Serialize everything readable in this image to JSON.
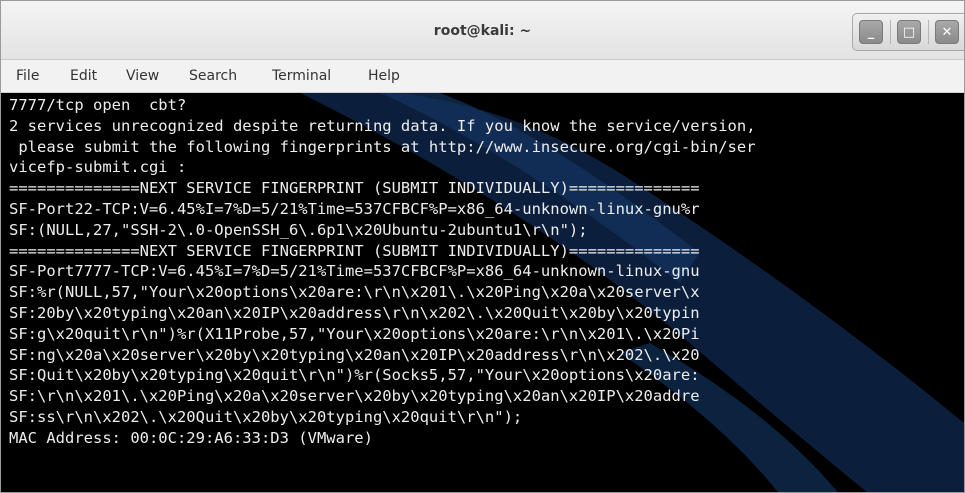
{
  "window": {
    "title": "root@kali: ~",
    "controls": {
      "minimize_glyph": "_",
      "maximize_glyph": "□",
      "close_glyph": "✕"
    }
  },
  "menubar": {
    "items": [
      "File",
      "Edit",
      "View",
      "Search",
      "Terminal",
      "Help"
    ]
  },
  "terminal": {
    "colors": {
      "background": "#000000",
      "foreground": "#ededed",
      "accent": "#0f2a55"
    },
    "lines": [
      "7777/tcp open  cbt?",
      "2 services unrecognized despite returning data. If you know the service/version,",
      " please submit the following fingerprints at http://www.insecure.org/cgi-bin/ser",
      "vicefp-submit.cgi :",
      "==============NEXT SERVICE FINGERPRINT (SUBMIT INDIVIDUALLY)==============",
      "SF-Port22-TCP:V=6.45%I=7%D=5/21%Time=537CFBCF%P=x86_64-unknown-linux-gnu%r",
      "SF:(NULL,27,\"SSH-2\\.0-OpenSSH_6\\.6p1\\x20Ubuntu-2ubuntu1\\r\\n\");",
      "==============NEXT SERVICE FINGERPRINT (SUBMIT INDIVIDUALLY)==============",
      "SF-Port7777-TCP:V=6.45%I=7%D=5/21%Time=537CFBCF%P=x86_64-unknown-linux-gnu",
      "SF:%r(NULL,57,\"Your\\x20options\\x20are:\\r\\n\\x201\\.\\x20Ping\\x20a\\x20server\\x",
      "SF:20by\\x20typing\\x20an\\x20IP\\x20address\\r\\n\\x202\\.\\x20Quit\\x20by\\x20typin",
      "SF:g\\x20quit\\r\\n\")%r(X11Probe,57,\"Your\\x20options\\x20are:\\r\\n\\x201\\.\\x20Pi",
      "SF:ng\\x20a\\x20server\\x20by\\x20typing\\x20an\\x20IP\\x20address\\r\\n\\x202\\.\\x20",
      "SF:Quit\\x20by\\x20typing\\x20quit\\r\\n\")%r(Socks5,57,\"Your\\x20options\\x20are:",
      "SF:\\r\\n\\x201\\.\\x20Ping\\x20a\\x20server\\x20by\\x20typing\\x20an\\x20IP\\x20addre",
      "SF:ss\\r\\n\\x202\\.\\x20Quit\\x20by\\x20typing\\x20quit\\r\\n\");",
      "MAC Address: 00:0C:29:A6:33:D3 (VMware)"
    ]
  }
}
